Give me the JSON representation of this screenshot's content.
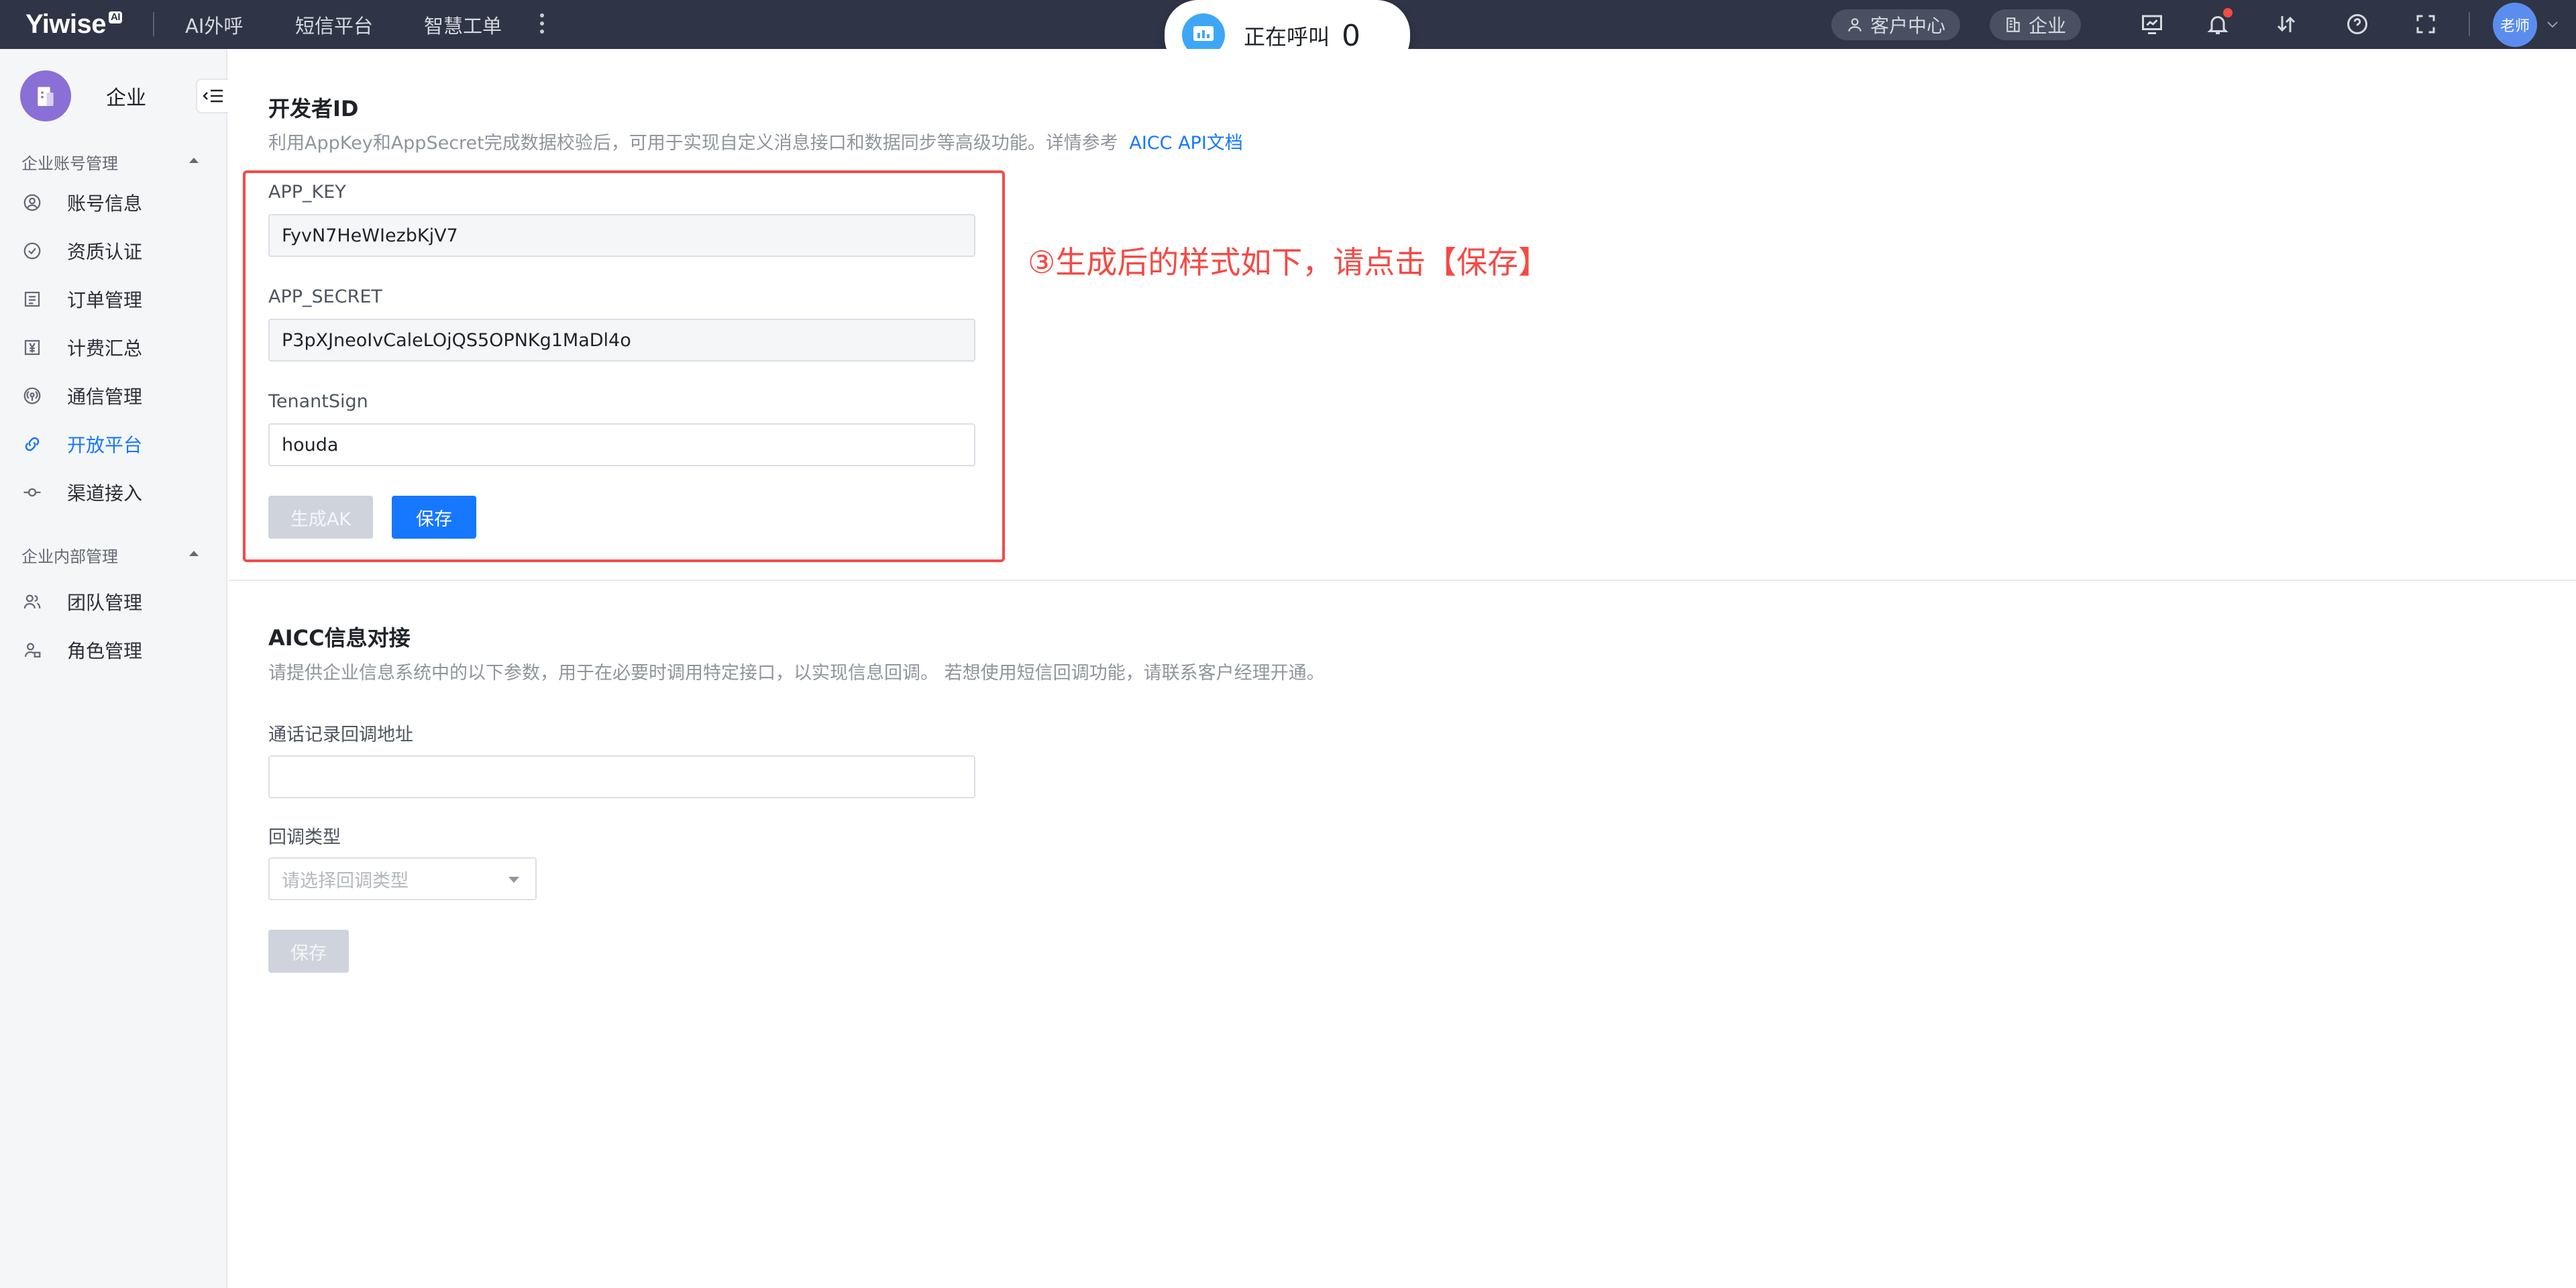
{
  "topbar": {
    "logo": "Yiwise",
    "logo_badge": "AI",
    "nav": [
      "AI外呼",
      "短信平台",
      "智慧工单"
    ],
    "call_label": "正在呼叫",
    "call_count": "0",
    "customer_center": "客户中心",
    "enterprise": "企业",
    "avatar_text": "老师"
  },
  "sidebar": {
    "title": "企业",
    "group1": "企业账号管理",
    "group1_items": [
      "账号信息",
      "资质认证",
      "订单管理",
      "计费汇总",
      "通信管理",
      "开放平台",
      "渠道接入"
    ],
    "group2": "企业内部管理",
    "group2_items": [
      "团队管理",
      "角色管理"
    ],
    "active_item": "开放平台"
  },
  "developer": {
    "title": "开发者ID",
    "desc": "利用AppKey和AppSecret完成数据校验后，可用于实现自定义消息接口和数据同步等高级功能。详情参考",
    "doc_link": "AICC API文档",
    "app_key_label": "APP_KEY",
    "app_key_value": "FyvN7HeWIezbKjV7",
    "app_secret_label": "APP_SECRET",
    "app_secret_value": "P3pXJneoIvCaleLOjQS5OPNKg1MaDl4o",
    "tenant_label": "TenantSign",
    "tenant_value": "houda",
    "generate_btn": "生成AK",
    "save_btn": "保存"
  },
  "annotation": "③生成后的样式如下，请点击【保存】",
  "aicc": {
    "title": "AICC信息对接",
    "desc": "请提供企业信息系统中的以下参数，用于在必要时调用特定接口，以实现信息回调。 若想使用短信回调功能，请联系客户经理开通。",
    "callback_url_label": "通话记录回调地址",
    "callback_url_value": "",
    "callback_type_label": "回调类型",
    "callback_type_placeholder": "请选择回调类型",
    "save_btn": "保存"
  },
  "colors": {
    "topbar": "#2f3546",
    "primary": "#1677ff",
    "annotation": "#f54a45",
    "sidebar_bg": "#f5f6f8"
  }
}
